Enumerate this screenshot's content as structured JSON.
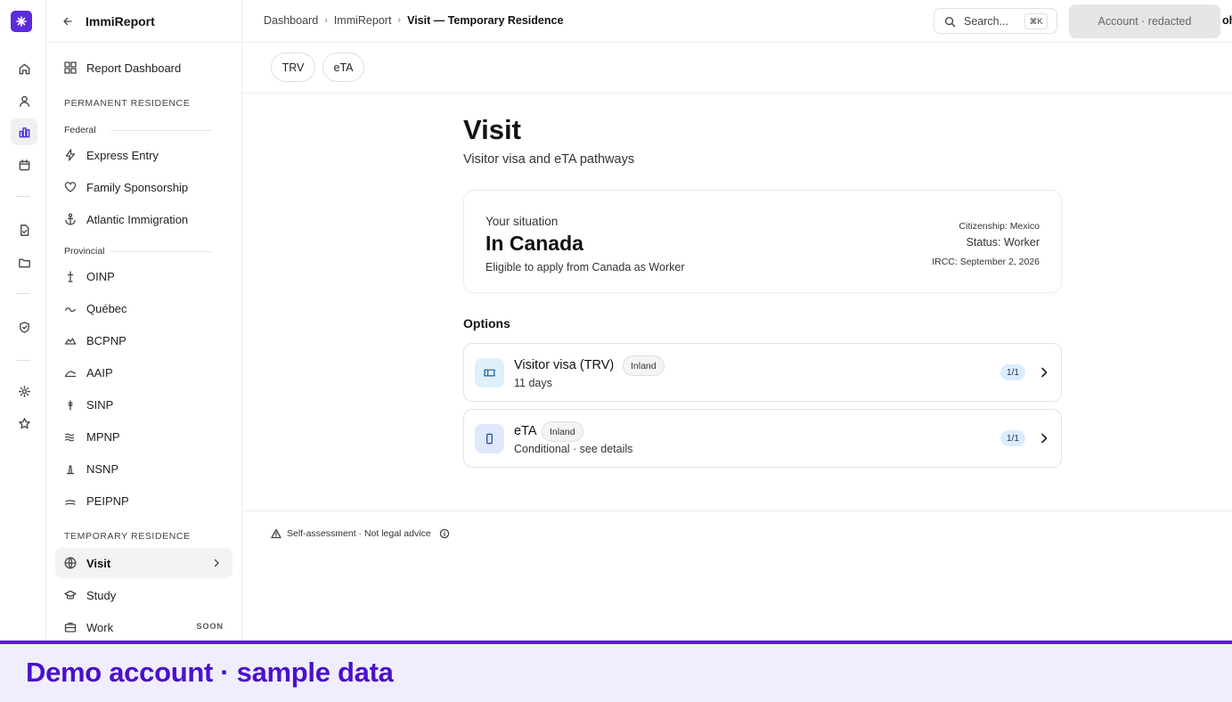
{
  "app": {
    "name": "ImmiReport"
  },
  "rail": {
    "items": [
      {
        "icon": "home-icon"
      },
      {
        "icon": "user-icon"
      },
      {
        "icon": "bar-chart-icon",
        "active": true
      },
      {
        "icon": "calendar-icon"
      },
      {
        "icon": "document-check-icon"
      },
      {
        "icon": "folder-icon"
      },
      {
        "icon": "shield-check-icon"
      },
      {
        "icon": "settings-icon"
      },
      {
        "icon": "star-icon"
      }
    ]
  },
  "sidebar": {
    "title": "ImmiReport",
    "dashboard": "Report Dashboard",
    "permanent_heading": "PERMANENT RESIDENCE",
    "federal_label": "Federal",
    "federal": [
      "Express Entry",
      "Family Sponsorship",
      "Atlantic Immigration"
    ],
    "provincial_label": "Provincial",
    "provincial": [
      "OINP",
      "Québec",
      "BCPNP",
      "AAIP",
      "SINP",
      "MPNP",
      "NSNP",
      "PEIPNP"
    ],
    "temporary_heading": "TEMPORARY RESIDENCE",
    "temporary": [
      {
        "label": "Visit",
        "active": true
      },
      {
        "label": "Study"
      },
      {
        "label": "Work",
        "badge": "SOON"
      }
    ]
  },
  "topbar": {
    "breadcrumb": [
      "Dashboard",
      "ImmiReport",
      "Visit — Temporary Residence"
    ],
    "search_label": "Search...",
    "search_shortcut": "⌘K",
    "account": "Account · redacted",
    "account_tail": "oh"
  },
  "tabs": [
    "TRV",
    "eTA"
  ],
  "main": {
    "title": "Visit",
    "subtitle": "Visitor visa and eTA pathways",
    "situation": {
      "label": "Your situation",
      "value": "In Canada",
      "description": "Eligible to apply from Canada as Worker",
      "citizenship": "Citizenship: Mexico",
      "status": "Status: Worker",
      "ircc": "IRCC: September 2, 2026"
    },
    "options_heading": "Options",
    "options": [
      {
        "title": "Visitor visa (TRV)",
        "badge": "Inland",
        "subtitle": "11 days",
        "count": "1/1",
        "icon": "ticket-icon"
      },
      {
        "title": "eTA",
        "badge": "Inland",
        "subtitle": "Conditional · see details",
        "count": "1/1",
        "icon": "phone-icon"
      }
    ]
  },
  "footer": {
    "disclaimer": "Self-assessment · Not legal advice"
  },
  "banner": {
    "text": "Demo account · sample data"
  },
  "colors": {
    "accent": "#5b2be0",
    "banner_text": "#4a10cc",
    "banner_bg": "#f0eefc"
  }
}
